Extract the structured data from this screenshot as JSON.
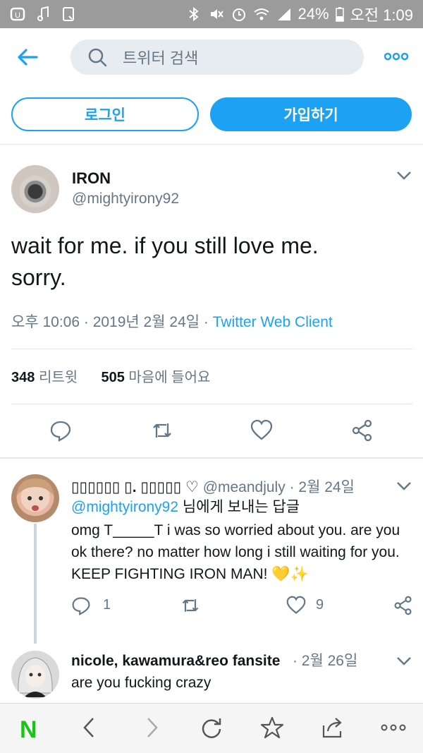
{
  "status_bar": {
    "battery": "24%",
    "time": "오전 1:09"
  },
  "search": {
    "placeholder": "트위터 검색"
  },
  "auth": {
    "login": "로그인",
    "signup": "가입하기"
  },
  "tweet": {
    "name": "IRON",
    "handle": "@mightyirony92",
    "text_line1": "wait for me. if you still love me.",
    "text_line2": "sorry.",
    "time": "오후 10:06 · 2019년 2월 24일 · ",
    "client": "Twitter Web Client",
    "retweets": "348",
    "retweets_label": "리트윗",
    "likes": "505",
    "likes_label": "마음에 들어요"
  },
  "replies": [
    {
      "name": "▯▯▯▯▯▯ ▯. ▯▯▯▯▯ ♡",
      "handle": "@meandjuly",
      "date": "· 2월 24일",
      "reply_to": "@mightyirony92",
      "reply_to_suffix": "님에게 보내는 답글",
      "text": "omg T_____T i was so worried about you. are you ok there? no matter how long i still waiting for you. KEEP FIGHTING IRON MAN! 💛✨",
      "reply_count": "1",
      "like_count": "9"
    },
    {
      "name": "nicole, kawamura&reo fansite",
      "date": "· 2월 26일",
      "text": "are you fucking crazy"
    }
  ],
  "bottom_nav": {
    "logo": "N"
  },
  "colors": {
    "accent": "#1da1f2",
    "text": "#14171a",
    "muted": "#657786"
  }
}
